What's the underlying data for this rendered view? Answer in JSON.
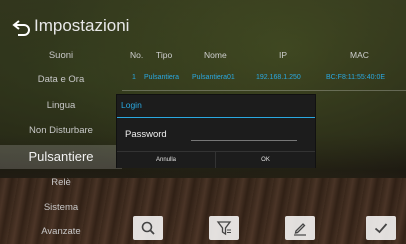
{
  "header": {
    "title": "Impostazioni"
  },
  "sidebar": {
    "items": [
      {
        "label": "Suoni"
      },
      {
        "label": "Data e Ora"
      },
      {
        "label": "Lingua"
      },
      {
        "label": "Non Disturbare"
      },
      {
        "label": "Pulsantiere",
        "active": true
      },
      {
        "label": "Relè"
      },
      {
        "label": "Sistema"
      },
      {
        "label": "Avanzate"
      }
    ]
  },
  "table": {
    "columns": [
      "No.",
      "Tipo",
      "Nome",
      "IP",
      "MAC"
    ],
    "rows": [
      {
        "no": "1",
        "tipo": "Pulsantiera",
        "nome": "Pulsantiera01",
        "ip": "192.168.1.250",
        "mac": "BC:F8:11:55:40:0E"
      }
    ]
  },
  "dialog": {
    "title": "Login",
    "password_label": "Password",
    "password_value": "",
    "cancel_label": "Annulla",
    "ok_label": "OK"
  },
  "toolbar": {
    "icons": [
      "search-icon",
      "filter-icon",
      "edit-icon",
      "check-icon"
    ]
  },
  "colors": {
    "accent": "#2aa8e0"
  }
}
